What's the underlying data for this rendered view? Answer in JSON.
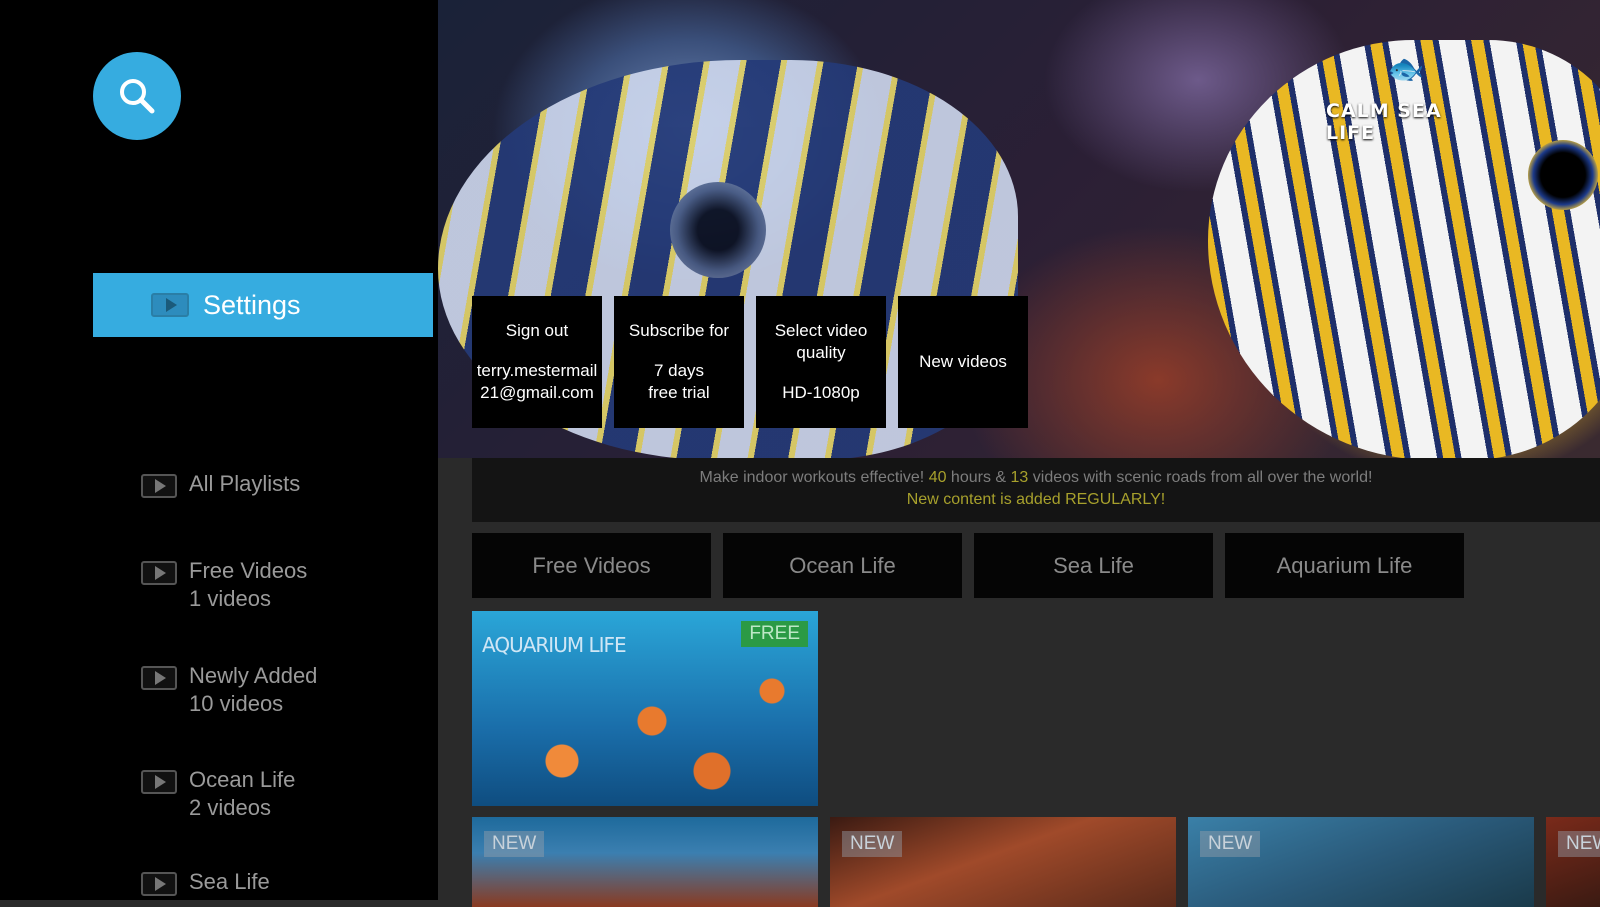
{
  "sidebar": {
    "search_icon": "search-icon",
    "settings_label": "Settings",
    "playlists": [
      {
        "title": "All Playlists",
        "count": ""
      },
      {
        "title": "Free Videos",
        "count": "1 videos"
      },
      {
        "title": "Newly Added",
        "count": "10 videos"
      },
      {
        "title": "Ocean Life",
        "count": "2 videos"
      },
      {
        "title": "Sea Life",
        "count": ""
      }
    ]
  },
  "hero": {
    "logo_text": "CALM SEA LIFE",
    "tiles": {
      "signout": {
        "line1": "Sign out",
        "email": "terry.mestermail21@gmail.com"
      },
      "subscribe": {
        "line1": "Subscribe for",
        "line2": "7 days",
        "line3": "free trial"
      },
      "quality": {
        "line1": "Select video quality",
        "line2": "HD-1080p"
      },
      "new": {
        "line1": "New videos"
      }
    }
  },
  "banner": {
    "part1": "Make indoor workouts effective! ",
    "hours": "40",
    "part2": " hours & ",
    "videos": "13",
    "part3": " videos with scenic roads from all over the world!",
    "line2": "New content is added REGULARLY!"
  },
  "categories": [
    "Free Videos",
    "Ocean Life",
    "Sea Life",
    "Aquarium Life"
  ],
  "thumbnails": {
    "main": {
      "title": "AQUARIUM LIFE",
      "badge": "FREE"
    },
    "row": [
      {
        "badge": "NEW"
      },
      {
        "badge": "NEW"
      },
      {
        "badge": "NEW"
      },
      {
        "badge": "NEW"
      }
    ]
  },
  "colors": {
    "accent": "#36ace0",
    "highlight": "#a7a02c",
    "free_badge": "#2b9a45"
  }
}
